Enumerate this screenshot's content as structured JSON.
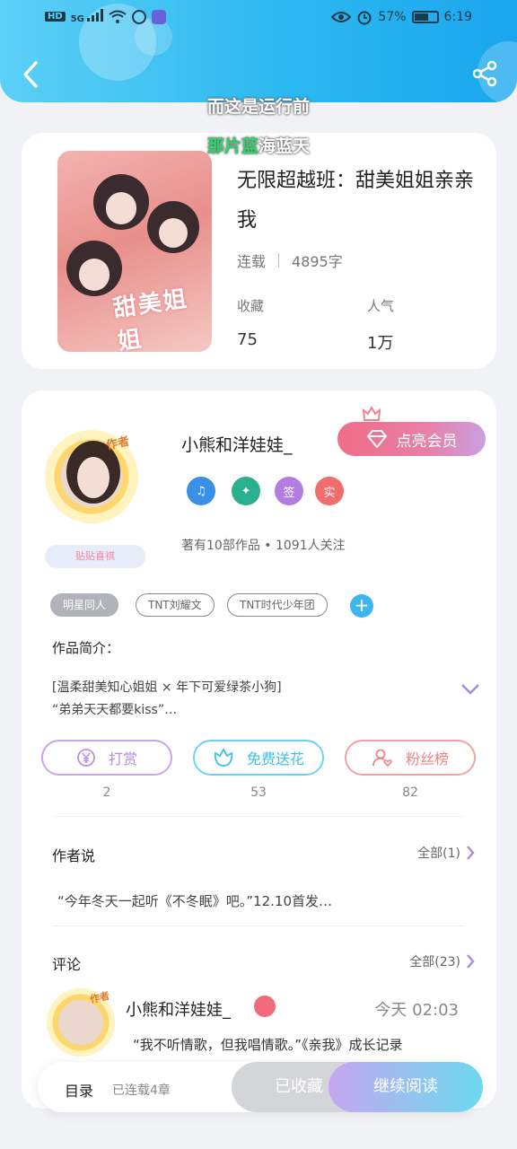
{
  "status_bar": {
    "left": {
      "hd": "HD",
      "net": "5G"
    },
    "battery": "57%",
    "time": "6:19"
  },
  "overlay": {
    "line1": "而这是运行前",
    "line2_green": "那片蓝",
    "line2_rest": "海蓝天"
  },
  "book": {
    "cover_text": "甜美姐姐",
    "title": "无限超越班：甜美姐姐亲亲我",
    "state": "连载",
    "words": "4895字",
    "stats": [
      {
        "label": "收藏",
        "value": "75"
      },
      {
        "label": "人气",
        "value": "1万"
      }
    ]
  },
  "author": {
    "avatar_tag": "作者",
    "deco_pill": "贴贴喜祺",
    "name": "小熊和洋娃娃_",
    "vip_button": "点亮会员",
    "badges": [
      "♫",
      "✦",
      "签",
      "实"
    ],
    "works_text": "著有10部作品 • 1091人关注"
  },
  "tags": [
    "明星同人",
    "TNT刘耀文",
    "TNT时代少年团"
  ],
  "intro": {
    "heading": "作品简介：",
    "line1": "[温柔甜美知心姐姐 × 年下可爱绿茶小狗]",
    "line2": "“弟弟天天都要kiss”…"
  },
  "actions": [
    {
      "label": "打赏",
      "count": "2",
      "color": "#b68ee6",
      "icon": "yen-icon"
    },
    {
      "label": "免费送花",
      "count": "53",
      "color": "#3fc0e6",
      "icon": "flower-icon"
    },
    {
      "label": "粉丝榜",
      "count": "82",
      "color": "#ee8585",
      "icon": "fans-icon"
    }
  ],
  "author_says": {
    "heading": "作者说",
    "all": "全部(1)",
    "quote": "“今年冬天一起听《不冬眠》吧。”12.10首发…"
  },
  "comments": {
    "heading": "评论",
    "all": "全部(23)",
    "items": [
      {
        "avatar_tag": "作者",
        "name": "小熊和洋娃娃_",
        "time": "今天  02:03",
        "text": "“我不听情歌，但我唱情歌。”《亲我》成长记录"
      }
    ]
  },
  "bottom_bar": {
    "catalog": "目录",
    "chapters": "已连载4章",
    "favorite": "已收藏",
    "read": "继续阅读"
  }
}
